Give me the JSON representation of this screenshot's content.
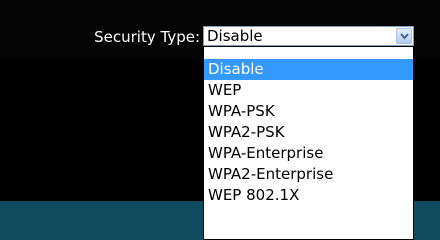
{
  "security": {
    "label": "Security Type:",
    "selected_value": "Disable",
    "options": [
      "Disable",
      "WEP",
      "WPA-PSK",
      "WPA2-PSK",
      "WPA-Enterprise",
      "WPA2-Enterprise",
      "WEP 802.1X"
    ],
    "highlighted_index": 0
  },
  "icons": {
    "dropdown_arrow": "chevron-down-icon"
  },
  "colors": {
    "highlight": "#3399ff",
    "bottom_band": "#0f4a5e",
    "background": "#000000"
  }
}
